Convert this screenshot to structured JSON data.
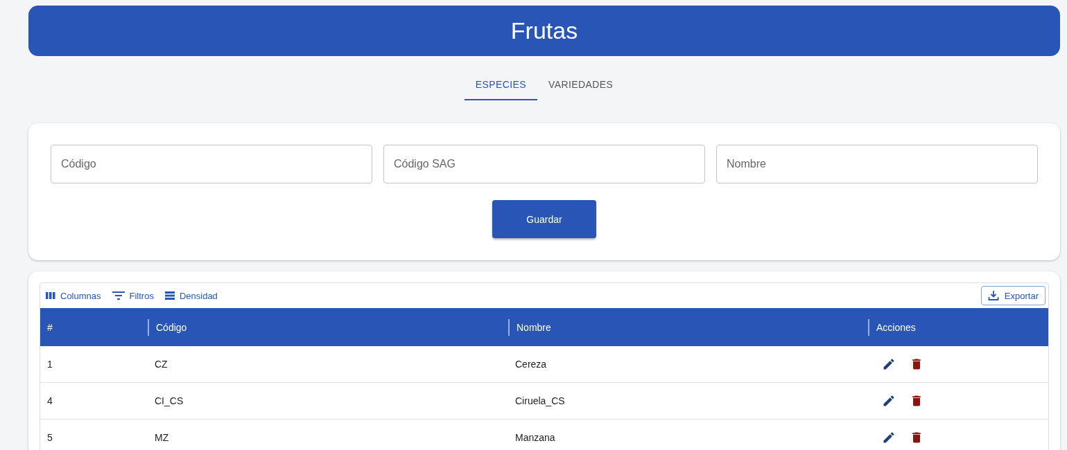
{
  "header": {
    "title": "Frutas"
  },
  "tabs": [
    {
      "label": "ESPECIES",
      "selected": true
    },
    {
      "label": "VARIEDADES",
      "selected": false
    }
  ],
  "form": {
    "fields": [
      {
        "placeholder": "Código"
      },
      {
        "placeholder": "Código SAG"
      },
      {
        "placeholder": "Nombre"
      }
    ],
    "submit": "Guardar"
  },
  "toolbar": {
    "buttons": [
      {
        "kind": "columns",
        "label": "Columnas"
      },
      {
        "kind": "filters",
        "label": "Filtros"
      },
      {
        "kind": "density",
        "label": "Densidad"
      }
    ],
    "export": "Exportar"
  },
  "table": {
    "columns": [
      "#",
      "Código",
      "Nombre",
      "Acciones"
    ],
    "rows": [
      {
        "cells": [
          "1",
          "CZ",
          "Cereza"
        ]
      },
      {
        "cells": [
          "4",
          "CI_CS",
          "Ciruela_CS"
        ]
      },
      {
        "cells": [
          "5",
          "MZ",
          "Manzana"
        ]
      }
    ]
  }
}
